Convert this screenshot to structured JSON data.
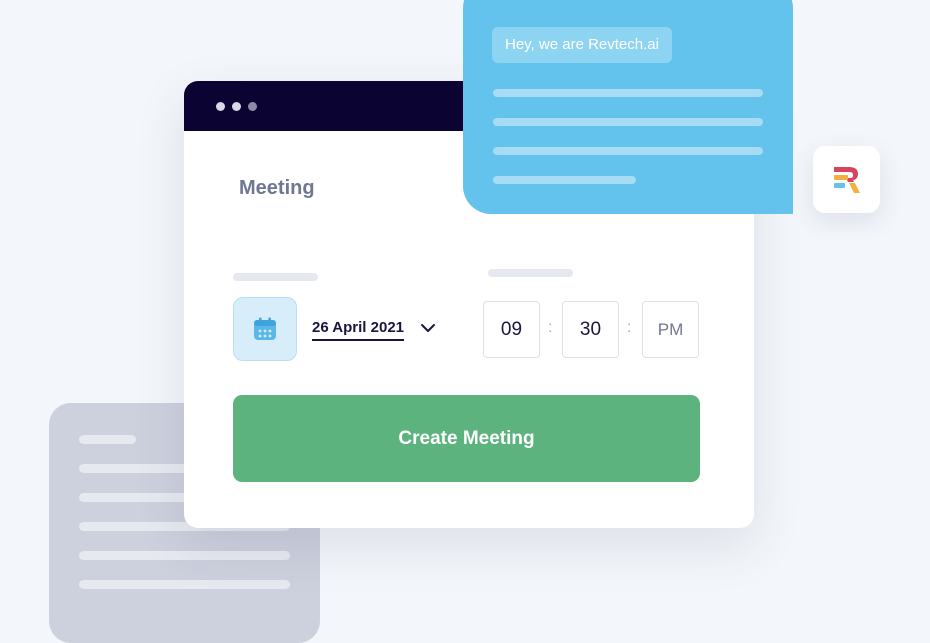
{
  "window": {
    "title": "Meeting"
  },
  "meeting_form": {
    "date": "26 April 2021",
    "hour": "09",
    "minute": "30",
    "period": "PM",
    "time_separator": ":",
    "submit_label": "Create Meeting"
  },
  "chat": {
    "greeting": "Hey, we are Revtech.ai"
  },
  "icons": {
    "calendar": "calendar-icon",
    "chevron": "chevron-down-icon",
    "logo": "revtech-logo"
  },
  "colors": {
    "titlebar": "#0b0432",
    "accent_green": "#5cb37e",
    "chat_blue": "#63c3ec",
    "calendar_tile": "#d7eefa",
    "logo_red": "#d9435f",
    "logo_orange": "#f1b040",
    "logo_blue": "#63c3ec"
  }
}
